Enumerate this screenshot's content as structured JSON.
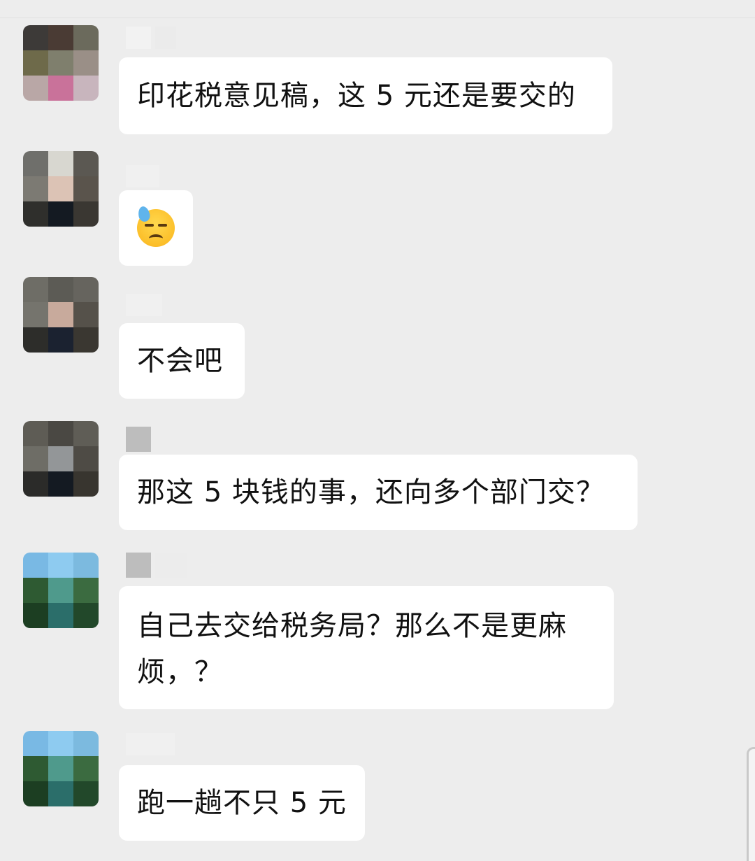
{
  "messages": [
    {
      "type": "text",
      "text": "印花税意见稿，这 5 元还是要交的"
    },
    {
      "type": "emoji",
      "icon": "downcast-face-with-sweat-emoji"
    },
    {
      "type": "text",
      "text": "不会吧"
    },
    {
      "type": "text",
      "text": "那这 5 块钱的事，还向多个部门交？"
    },
    {
      "type": "text",
      "text": "自己去交给税务局？那么不是更麻烦，？"
    },
    {
      "type": "text",
      "text": "跑一趟不只 5 元"
    }
  ],
  "colors": {
    "background": "#ededed",
    "bubble": "#ffffff",
    "text": "#111111"
  }
}
